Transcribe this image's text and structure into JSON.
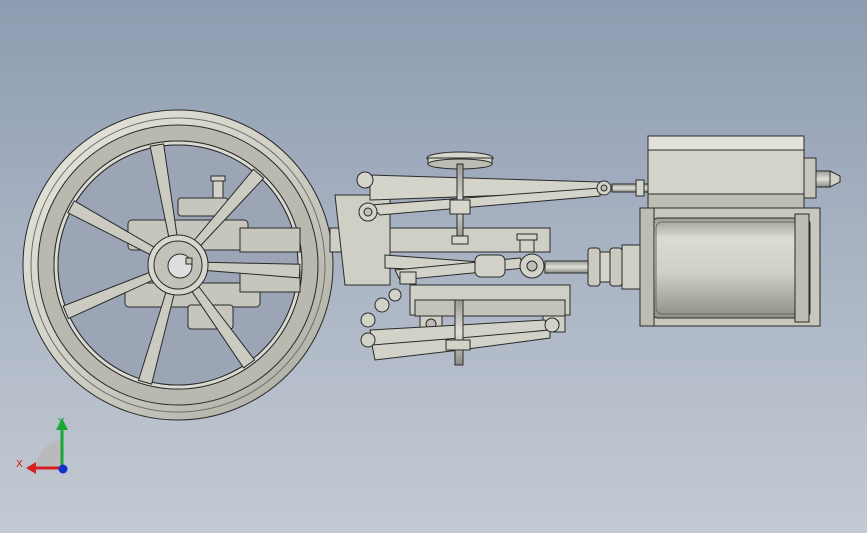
{
  "viewport": {
    "background_top": "#8e9cb1",
    "background_bottom": "#c4cad3",
    "part_color": "#d2d2c8",
    "edge_color": "#2a2a2a"
  },
  "triad": {
    "x_label": "X",
    "y_label": "Y",
    "x_color": "#d42020",
    "y_color": "#18a838",
    "z_color": "#1030d0"
  }
}
